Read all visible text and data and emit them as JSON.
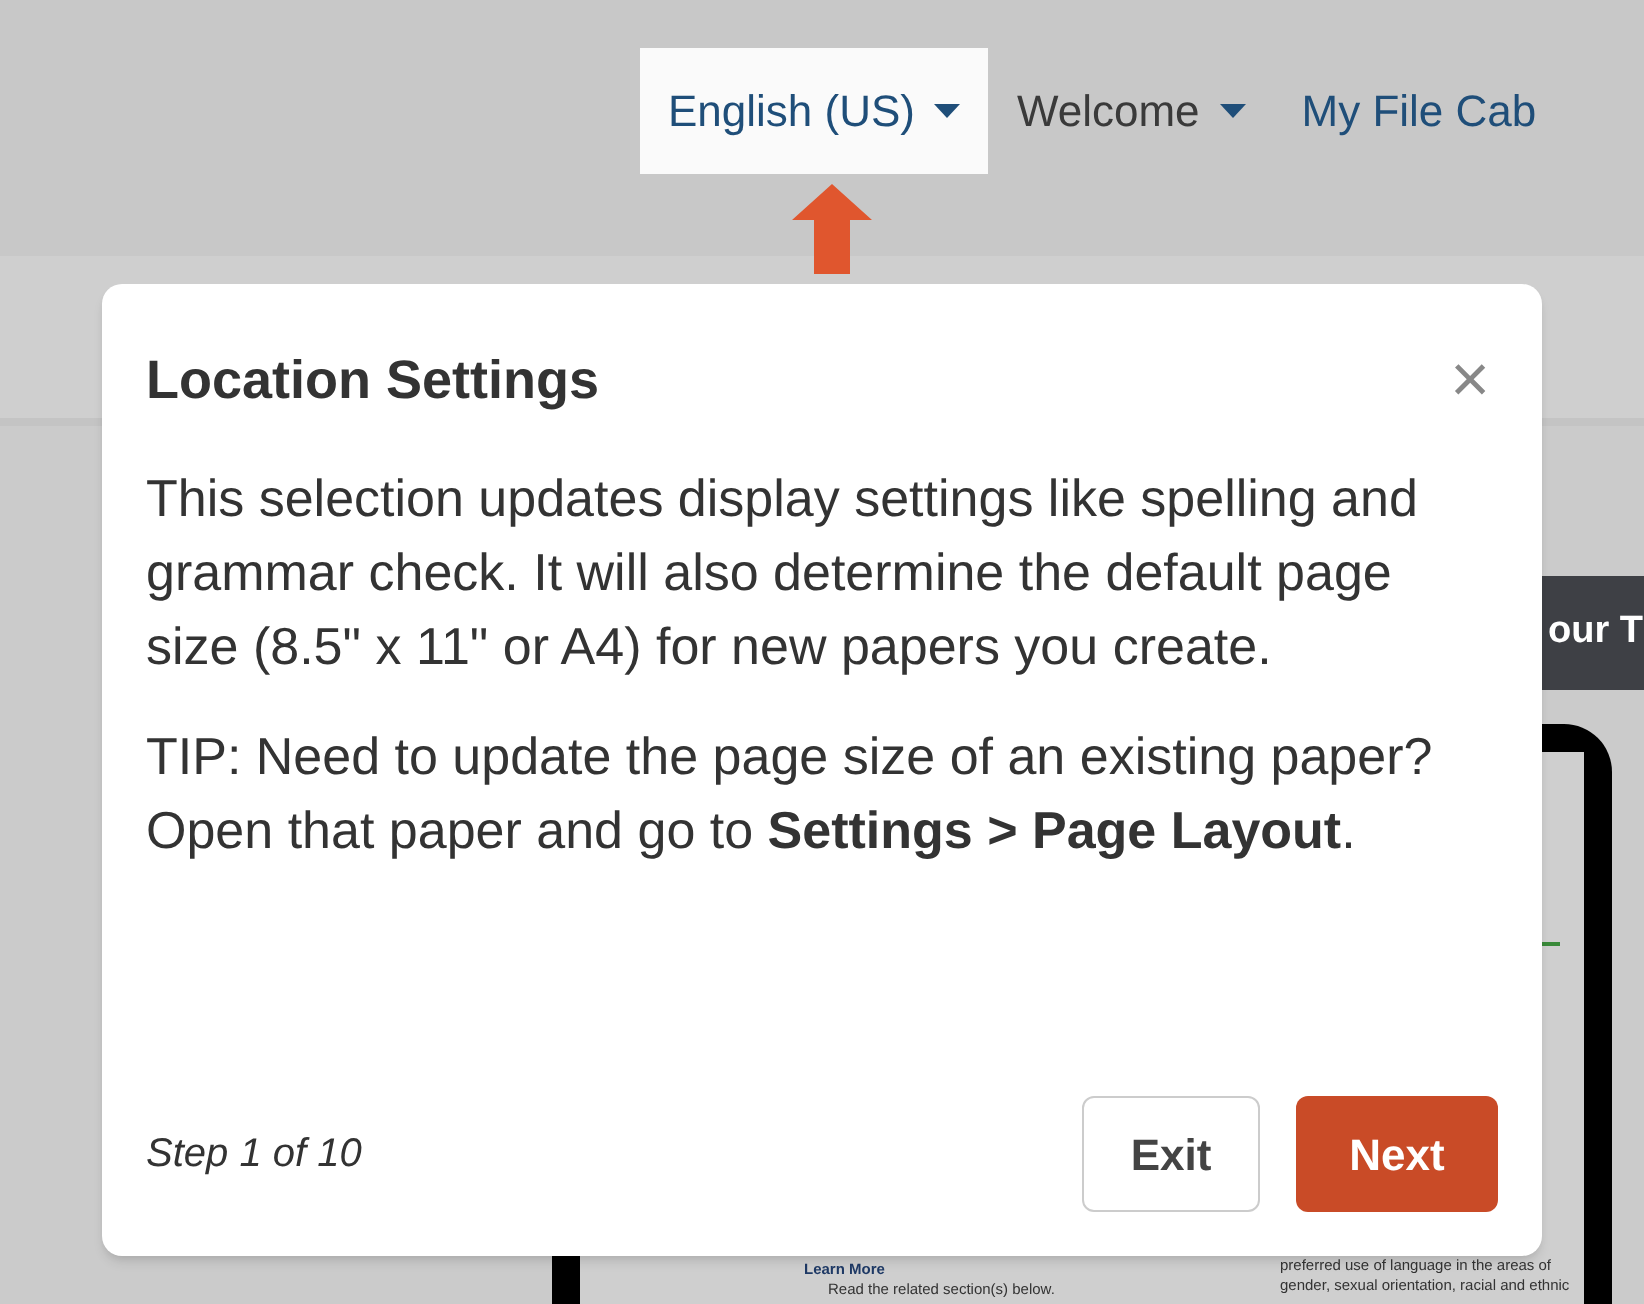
{
  "nav": [
    {
      "label": "English (US)",
      "kind": "dropdown",
      "selected": true
    },
    {
      "label": "Welcome",
      "kind": "dropdown",
      "selected": false
    },
    {
      "label": "My File Cab",
      "kind": "link",
      "selected": false
    }
  ],
  "banner": {
    "label": "our T"
  },
  "preview": {
    "left": [
      "Learn More",
      "Read the related section(s) below."
    ],
    "right": [
      "preferred use of language in the areas of",
      "gender, sexual orientation, racial and ethnic"
    ]
  },
  "popover": {
    "title": "Location Settings",
    "close": "×",
    "paragraphs": [
      "This selection updates display settings like spelling and grammar check. It will also determine the default page size (8.5\" x 11\" or A4) for new papers you create.",
      "TIP: Need to update the page size of an existing paper? Open that paper and go to **Settings > Page Layout**."
    ],
    "step": "Step 1 of 10",
    "buttons": [
      {
        "label": "Exit",
        "kind": "secondary"
      },
      {
        "label": "Next",
        "kind": "primary"
      }
    ]
  }
}
